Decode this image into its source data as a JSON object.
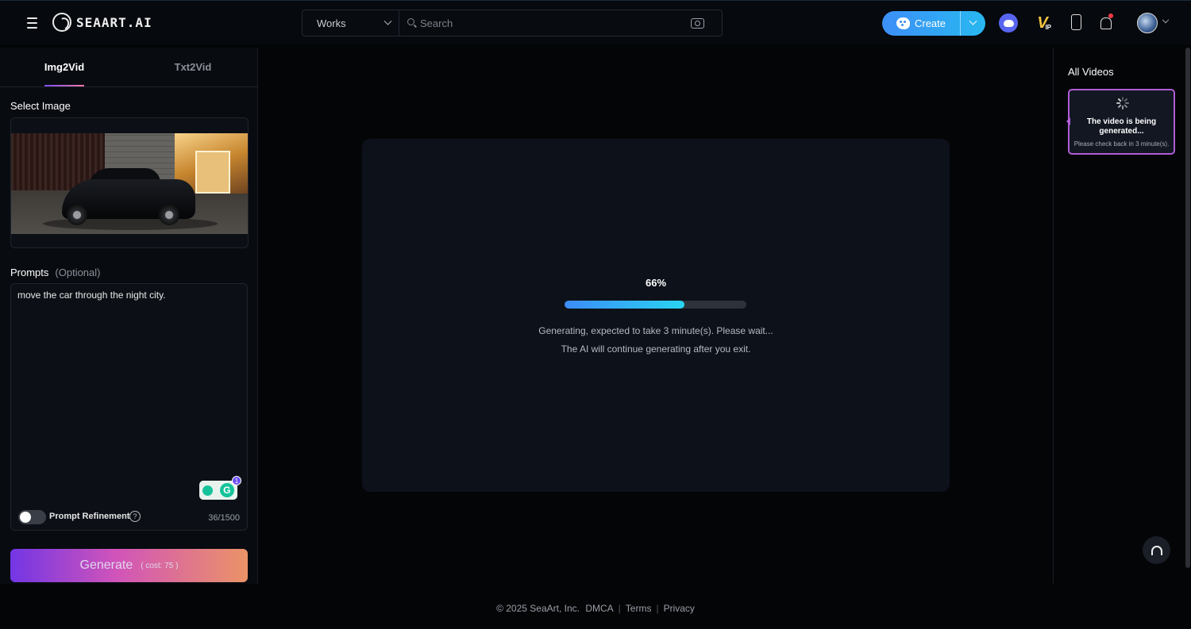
{
  "header": {
    "logo_text": "SEAART.AI",
    "search": {
      "category": "Works",
      "placeholder": "Search"
    },
    "create_label": "Create",
    "vip_badge": "V",
    "vip_sub": "IP"
  },
  "left": {
    "tabs": [
      {
        "label": "Img2Vid",
        "active": true
      },
      {
        "label": "Txt2Vid",
        "active": false
      }
    ],
    "select_image_label": "Select Image",
    "prompts_label": "Prompts",
    "prompts_optional": "(Optional)",
    "prompt_value": "move the car through the night city.",
    "grammarly_count": "1",
    "prompt_refinement_label": "Prompt Refinement",
    "prompt_refinement_enabled": false,
    "char_count": "36/1500",
    "generate_label": "Generate",
    "generate_cost": "( cost: 75 )"
  },
  "center": {
    "percent_text": "66%",
    "progress": 0.66,
    "status_line_1": "Generating, expected to take 3 minute(s). Please wait...",
    "status_line_2": "The AI will continue generating after you exit."
  },
  "right": {
    "title": "All Videos",
    "card_title": "The video is being generated...",
    "card_sub": "Please check back in 3 minute(s)."
  },
  "footer": {
    "copyright": "© 2025 SeaArt, Inc.",
    "dmca": "DMCA",
    "terms": "Terms",
    "privacy": "Privacy",
    "separator": "|"
  },
  "colors": {
    "accent_blue": "#3d8ff8",
    "accent_purple": "#7c3af7",
    "card_border": "#b05dd6",
    "notification": "#ff3b46"
  }
}
